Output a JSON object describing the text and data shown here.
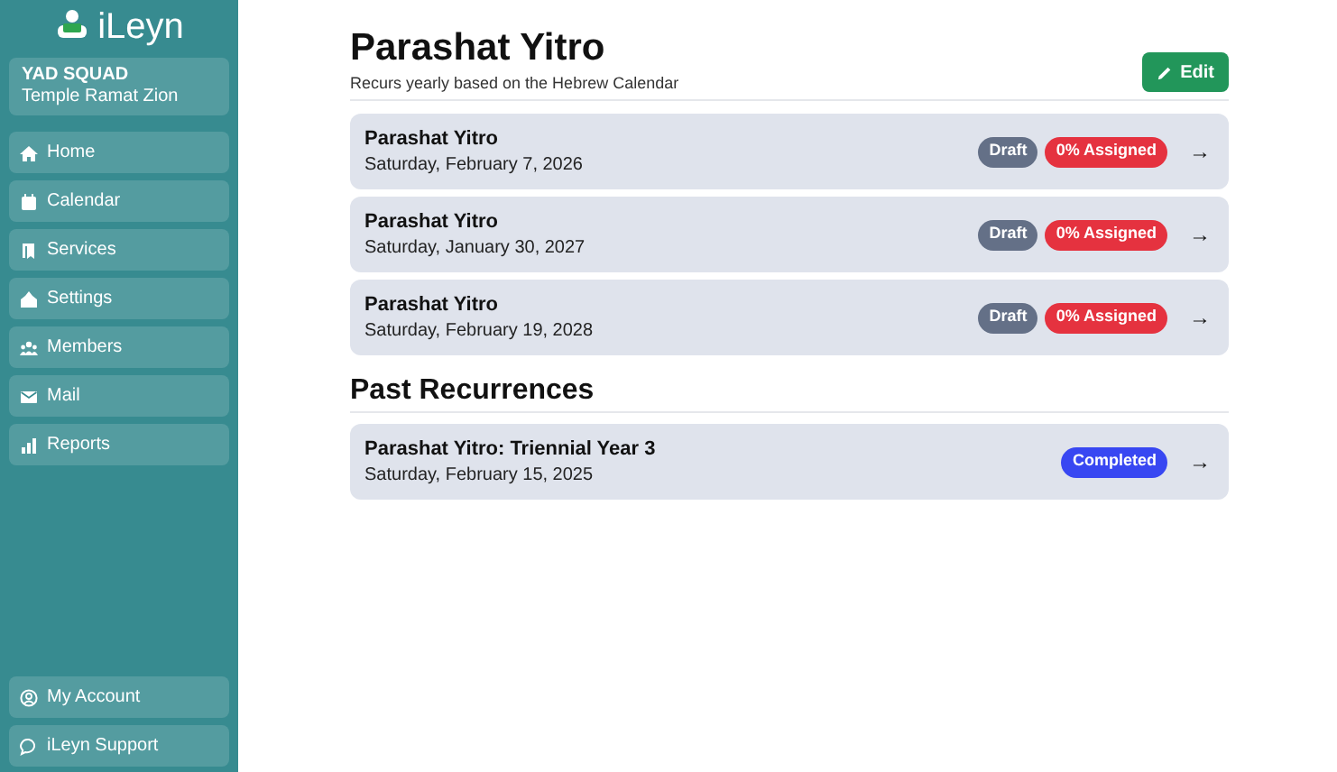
{
  "sidebar": {
    "logo": "iLeyn",
    "org": {
      "name": "YAD SQUAD",
      "subtitle": "Temple Ramat Zion"
    },
    "items": [
      {
        "label": "Home"
      },
      {
        "label": "Calendar"
      },
      {
        "label": "Services"
      },
      {
        "label": "Settings"
      },
      {
        "label": "Members"
      },
      {
        "label": "Mail"
      },
      {
        "label": "Reports"
      }
    ],
    "bottom_items": [
      {
        "label": "My Account"
      },
      {
        "label": "iLeyn Support"
      }
    ]
  },
  "header": {
    "title": "Parashat Yitro",
    "subtitle": "Recurs yearly based on the Hebrew Calendar",
    "edit_button": "Edit"
  },
  "upcoming": [
    {
      "title": "Parashat Yitro",
      "date": "Saturday, February 7, 2026",
      "badges": [
        {
          "label": "Draft",
          "kind": "draft"
        },
        {
          "label": "0% Assigned",
          "kind": "assigned"
        }
      ],
      "arrow": "→"
    },
    {
      "title": "Parashat Yitro",
      "date": "Saturday, January 30, 2027",
      "badges": [
        {
          "label": "Draft",
          "kind": "draft"
        },
        {
          "label": "0% Assigned",
          "kind": "assigned"
        }
      ],
      "arrow": "→"
    },
    {
      "title": "Parashat Yitro",
      "date": "Saturday, February 19, 2028",
      "badges": [
        {
          "label": "Draft",
          "kind": "draft"
        },
        {
          "label": "0% Assigned",
          "kind": "assigned"
        }
      ],
      "arrow": "→"
    }
  ],
  "past_heading": "Past Recurrences",
  "past": [
    {
      "title": "Parashat Yitro: Triennial Year 3",
      "date": "Saturday, February 15, 2025",
      "badges": [
        {
          "label": "Completed",
          "kind": "completed"
        }
      ],
      "arrow": "→"
    }
  ]
}
